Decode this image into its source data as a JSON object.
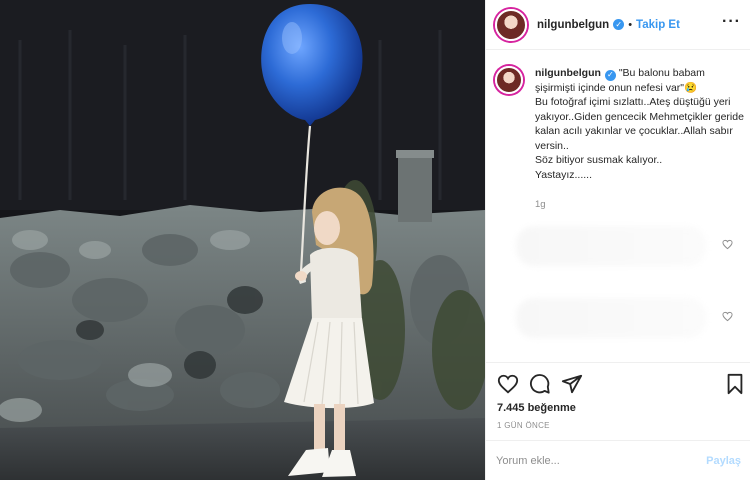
{
  "post": {
    "username": "nilgunbelgun",
    "follow_label": "Takip Et",
    "separator": "•",
    "more_icon": "more-options-icon"
  },
  "caption": {
    "username": "nilgunbelgun",
    "text": " \"Bu balonu babam şişirmişti içinde onun nefesi var\"😢\nBu fotoğraf içimi sızlattı..Ateş düştüğü yeri yakıyor..Giden gencecik Mehmetçikler geride kalan acılı yakınlar ve çocuklar..Allah sabır versin..\nSöz bitiyor susmak kalıyor..\nYastayız......",
    "time": "1g"
  },
  "actions": {
    "icons": [
      "heart-icon",
      "comment-icon",
      "share-icon",
      "bookmark-icon"
    ],
    "likes": "7.445 beğenme",
    "time_ago": "1 GÜN ÖNCE"
  },
  "comment_box": {
    "placeholder": "Yorum ekle...",
    "post_label": "Paylaş"
  },
  "colors": {
    "accent": "#3897f0",
    "post_disabled": "#b3dbff",
    "balloon": "#2d6bd6"
  }
}
